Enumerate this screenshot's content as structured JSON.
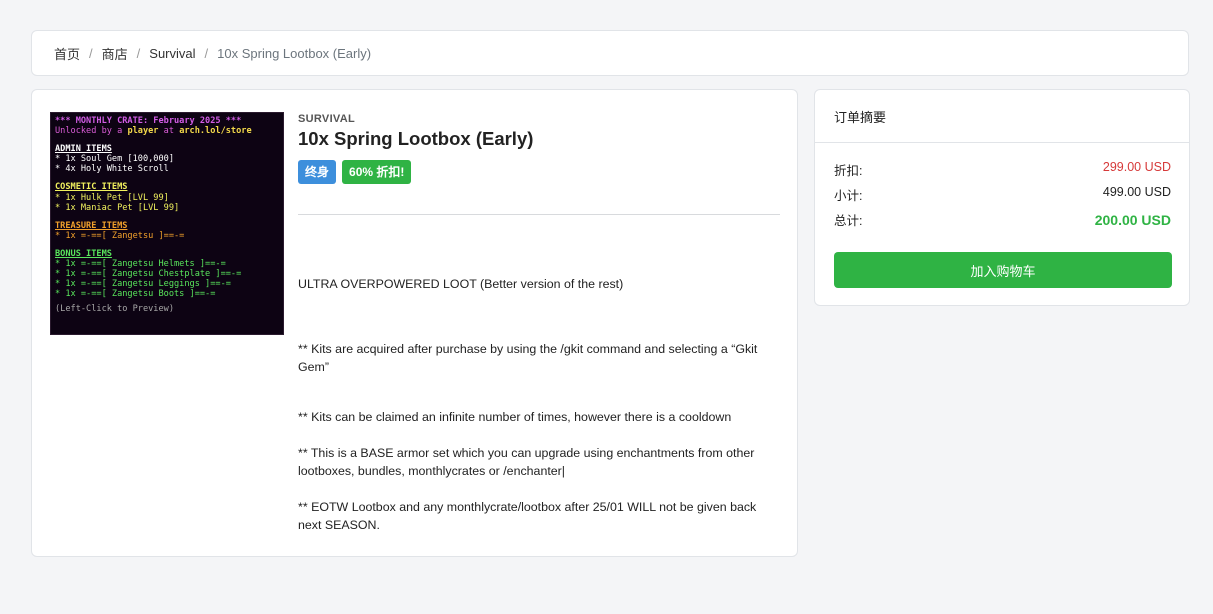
{
  "breadcrumb": {
    "home": "首页",
    "store": "商店",
    "category": "Survival",
    "current": "10x Spring Lootbox (Early)",
    "separator": "/"
  },
  "product": {
    "image_text": {
      "header": "*** MONTHLY CRATE: February 2025 ***",
      "unlock_prefix": "Unlocked by a ",
      "unlock_player": "player",
      "unlock_mid": " at ",
      "unlock_site": "arch.lol/store",
      "admin_title": "ADMIN ITEMS",
      "admin_items": [
        "* 1x Soul Gem [100,000]",
        "* 4x Holy White Scroll"
      ],
      "cosmetic_title": "COSMETIC ITEMS",
      "cosmetic_items": [
        "* 1x Hulk Pet [LVL 99]",
        "* 1x Maniac Pet [LVL 99]"
      ],
      "treasure_title": "TREASURE ITEMS",
      "treasure_items": [
        "* 1x =-==[ Zangetsu ]==-="
      ],
      "bonus_title": "BONUS ITEMS",
      "bonus_items": [
        "* 1x =-==[ Zangetsu Helmets ]==-=",
        "* 1x =-==[ Zangetsu Chestplate ]==-=",
        "* 1x =-==[ Zangetsu Leggings ]==-=",
        "* 1x =-==[ Zangetsu Boots ]==-="
      ],
      "footer": "(Left-Click to Preview)"
    },
    "category": "SURVIVAL",
    "title": "10x Spring Lootbox (Early)",
    "badge_lifetime": "终身",
    "badge_discount": "60% 折扣!",
    "description": [
      "ULTRA OVERPOWERED LOOT (Better version of the rest)",
      "** Kits are acquired after purchase by using the /gkit command and selecting a “Gkit Gem”",
      "** Kits can be claimed an infinite number of times, however there is a cooldown",
      "** This is a BASE armor set which you can upgrade using enchantments from other lootboxes, bundles, monthlycrates or /enchanter|",
      "** EOTW Lootbox and any monthlycrate/lootbox after 25/01 WILL not be given back next SEASON."
    ]
  },
  "summary": {
    "title": "订单摘要",
    "discount_label": "折扣:",
    "discount_value": "299.00 USD",
    "subtotal_label": "小计:",
    "subtotal_value": "499.00 USD",
    "total_label": "总计:",
    "total_value": "200.00 USD",
    "add_to_cart": "加入购物车"
  },
  "colors": {
    "accent_green": "#2fb344",
    "badge_blue": "#3d8fdc",
    "discount_red": "#d63939"
  }
}
